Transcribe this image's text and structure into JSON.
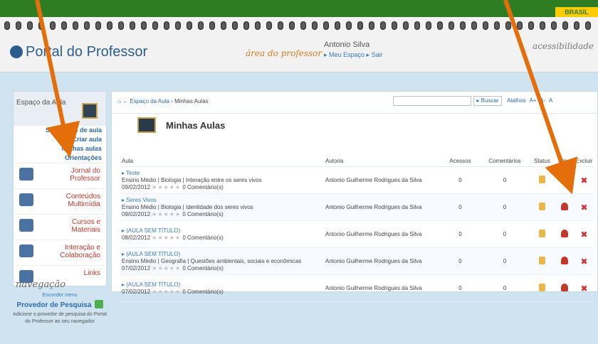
{
  "header": {
    "brasil": "BRASIL",
    "logo": "Portal do Professor",
    "area": "área do professor",
    "user_name": "Antonio Silva",
    "user_links": "▸ Meu Espaço ▸ Sair",
    "acessibilidade": "acessibilidade"
  },
  "sidebar": {
    "title": "Espaço da Aula",
    "sub_items": [
      "Sugestões de aula",
      "Criar aula",
      "Minhas aulas",
      "Orientações"
    ],
    "items": [
      {
        "label": "Jornal do Professor"
      },
      {
        "label": "Conteúdos Multimídia"
      },
      {
        "label": "Cursos e Materiais"
      },
      {
        "label": "Interação e Colaboração"
      },
      {
        "label": "Links"
      }
    ],
    "more": "Esconder menu",
    "nav": "navegação",
    "provider_title": "Provedor de Pesquisa",
    "provider_desc": "Adicione o provedor de pesquisa do Portal do Professor ao seu navegador"
  },
  "toolbar": {
    "crumb_1": "Espaço da Aula",
    "crumb_2": "Minhas Aulas",
    "search_button": "▸ Buscar",
    "shortcuts": "Atalhos A+ A- A"
  },
  "page": {
    "title": "Minhas Aulas"
  },
  "table": {
    "headers": [
      "Aula",
      "Autoria",
      "Acessos",
      "Comentários",
      "Status",
      "Tipo",
      "Excluir"
    ],
    "rows": [
      {
        "title": "▸ Teste",
        "desc": "Ensino Médio | Biologia | Interação entre os seres vivos",
        "date": "09/02/2012",
        "rating": "★★★★★",
        "comments": "0 Comentário(s)",
        "author": "Antonio Guilherme Rodrigues da Silva",
        "acessos": "0",
        "comentarios": "0"
      },
      {
        "title": "▸ Seres Vivos",
        "desc": "Ensino Médio | Biologia | Identidade dos seres vivos",
        "date": "09/02/2012",
        "rating": "★★★★★",
        "comments": "0 Comentário(s)",
        "author": "Antonio Guilherme Rodrigues da Silva",
        "acessos": "0",
        "comentarios": "0"
      },
      {
        "title": "▸ (AULA SEM TÍTULO)",
        "desc": "",
        "date": "08/02/2012",
        "rating": "★★★★★",
        "comments": "0 Comentário(s)",
        "author": "Antonio Guilherme Rodrigues da Silva",
        "acessos": "0",
        "comentarios": "0"
      },
      {
        "title": "▸ (AULA SEM TÍTULO)",
        "desc": "Ensino Médio | Geografia | Questões ambientais, sociais e econômicas",
        "date": "07/02/2012",
        "rating": "★★★★★",
        "comments": "0 Comentário(s)",
        "author": "Antonio Guilherme Rodrigues da Silva",
        "acessos": "0",
        "comentarios": "0"
      },
      {
        "title": "▸ (AULA SEM TÍTULO)",
        "desc": "",
        "date": "07/02/2012",
        "rating": "★★★★★",
        "comments": "0 Comentário(s)",
        "author": "Antonio Guilherme Rodrigues da Silva",
        "acessos": "0",
        "comentarios": "0"
      }
    ]
  },
  "icons": {
    "lock": "lock-icon",
    "person": "person-icon",
    "delete": "delete-icon"
  },
  "colors": {
    "topbar": "#2e7d23",
    "arrow": "#e46f0a",
    "link": "#3a7bbf"
  }
}
